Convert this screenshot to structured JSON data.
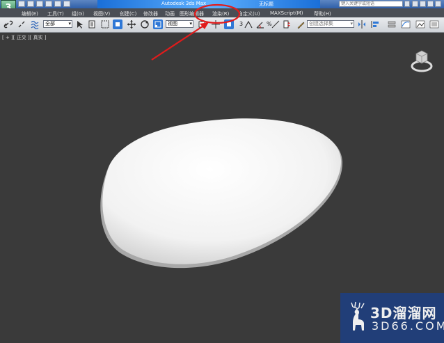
{
  "window": {
    "title": "Autodesk 3ds Max",
    "file": "无标题",
    "search_placeholder": "键入关键字或短语"
  },
  "menu": {
    "items": [
      "编辑(E)",
      "工具(T)",
      "组(G)",
      "视图(V)",
      "创建(C)",
      "修改器",
      "动画",
      "图形编辑器",
      "渲染(R)",
      "自定义(U)",
      "MAXScript(M)",
      "帮助(H)"
    ]
  },
  "toolbar": {
    "selection_filter": "全部",
    "reference_coordinate": "视图",
    "named_selection_placeholder": "创建选择集",
    "snap_number": "3",
    "percent_symbol": "%"
  },
  "viewport": {
    "label": "[ + ][ 正交 ][ 真实 ]"
  },
  "watermark": {
    "main": "3D溜溜网",
    "sub": "3D66.COM"
  },
  "colors": {
    "viewport_bg": "#3a3a3a",
    "menu_bg": "#4a4e55",
    "title_highlight": "#5db0ff",
    "annotation_red": "#e21b1b",
    "watermark_bg": "#1f3f7e"
  }
}
